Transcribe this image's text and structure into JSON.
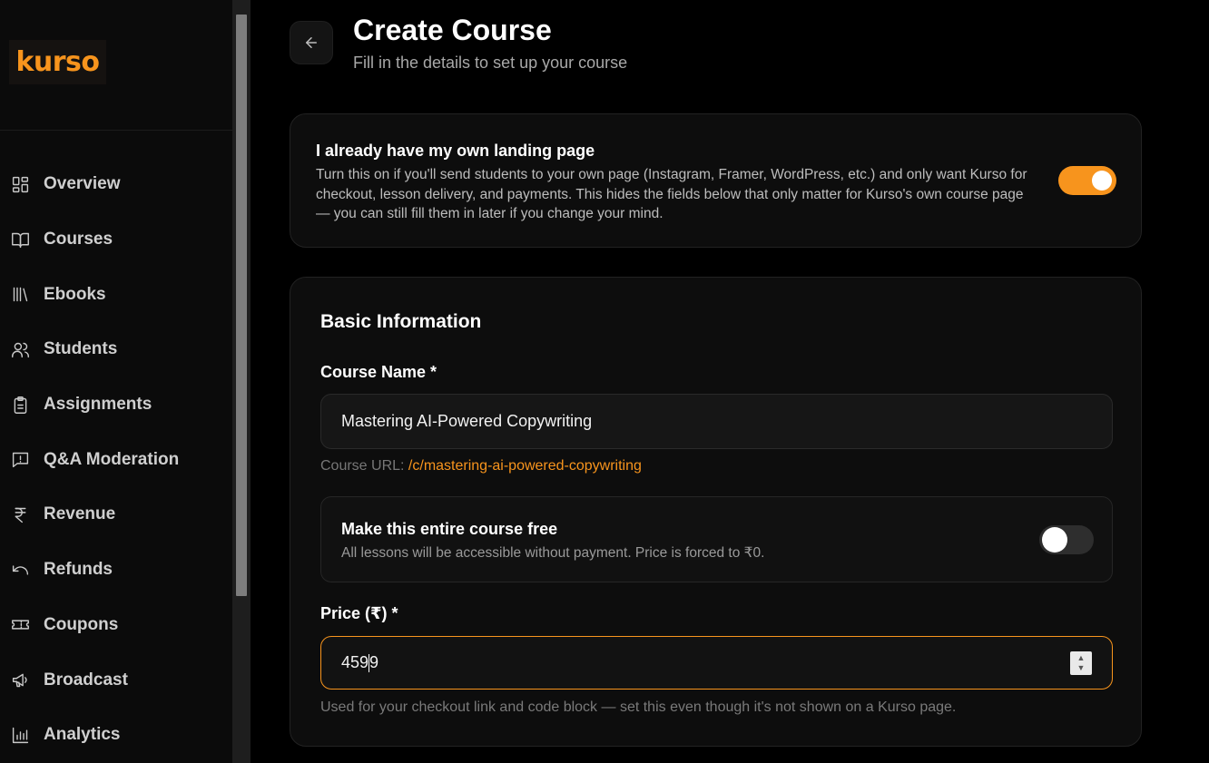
{
  "brand": {
    "logo": "kurso",
    "accent": "#f7941d"
  },
  "sidebar": {
    "items": [
      {
        "label": "Overview",
        "icon": "grid-icon"
      },
      {
        "label": "Courses",
        "icon": "book-open-icon"
      },
      {
        "label": "Ebooks",
        "icon": "library-icon"
      },
      {
        "label": "Students",
        "icon": "users-icon"
      },
      {
        "label": "Assignments",
        "icon": "clipboard-icon"
      },
      {
        "label": "Q&A Moderation",
        "icon": "message-alert-icon"
      },
      {
        "label": "Revenue",
        "icon": "rupee-icon"
      },
      {
        "label": "Refunds",
        "icon": "undo-icon"
      },
      {
        "label": "Coupons",
        "icon": "ticket-icon"
      },
      {
        "label": "Broadcast",
        "icon": "megaphone-icon"
      },
      {
        "label": "Analytics",
        "icon": "bar-chart-icon"
      }
    ]
  },
  "header": {
    "title": "Create Course",
    "subtitle": "Fill in the details to set up your course"
  },
  "landing": {
    "title": "I already have my own landing page",
    "description": "Turn this on if you'll send students to your own page (Instagram, Framer, WordPress, etc.) and only want Kurso for checkout, lesson delivery, and payments. This hides the fields below that only matter for Kurso's own course page — you can still fill them in later if you change your mind.",
    "toggle_on": true
  },
  "basic": {
    "section_title": "Basic Information",
    "course_name_label": "Course Name *",
    "course_name_value": "Mastering AI-Powered Copywriting",
    "course_url_label": "Course URL: ",
    "course_url_value": "/c/mastering-ai-powered-copywriting",
    "free_title": "Make this entire course free",
    "free_desc": "All lessons will be accessible without payment. Price is forced to ₹0.",
    "free_toggle_on": false,
    "price_label": "Price (₹) *",
    "price_value_before_caret": "459",
    "price_value_after_caret": "9",
    "price_help": "Used for your checkout link and code block — set this even though it's not shown on a Kurso page."
  }
}
